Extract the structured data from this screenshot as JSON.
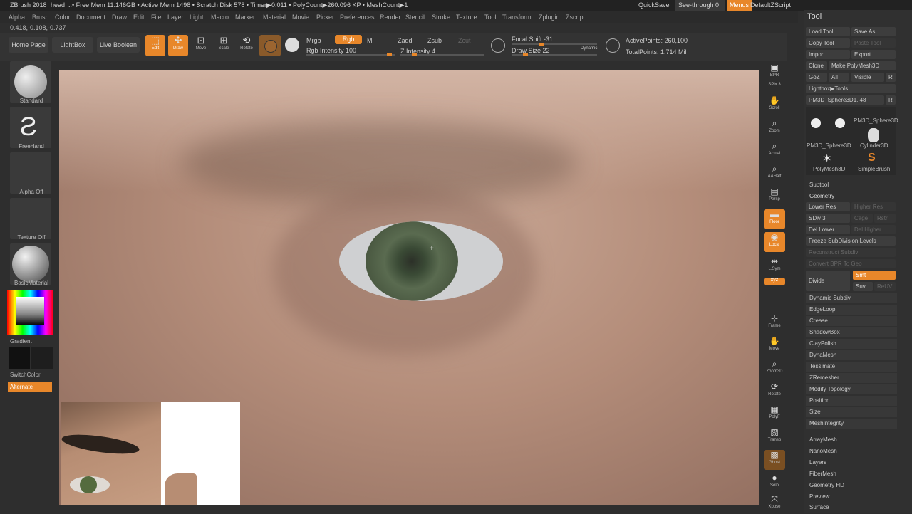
{
  "titlebar": {
    "app": "ZBrush 2018",
    "doc": "head",
    "stats": "..• Free Mem 11.146GB • Active Mem 1498 • Scratch Disk 578 • Timer▶0.011 • PolyCount▶260.096 KP • MeshCount▶1",
    "quicksave": "QuickSave",
    "see_through": "See-through  0",
    "menus": "Menus",
    "default_zscript": "DefaultZScript"
  },
  "menubar": [
    "Alpha",
    "Brush",
    "Color",
    "Document",
    "Draw",
    "Edit",
    "File",
    "Layer",
    "Light",
    "Macro",
    "Marker",
    "Material",
    "Movie",
    "Picker",
    "Preferences",
    "Render",
    "Stencil",
    "Stroke",
    "Texture",
    "Tool",
    "Transform",
    "Zplugin",
    "Zscript"
  ],
  "coords": "0.418,-0.108,-0.737",
  "toolbar": {
    "home_page": "Home Page",
    "lightbox": "LightBox",
    "live_boolean": "Live Boolean",
    "edit": "Edit",
    "draw": "Draw",
    "move": "Move",
    "scale": "Scale",
    "rotate": "Rotate",
    "mrgb": "Mrgb",
    "rgb": "Rgb",
    "m": "M",
    "rgb_intensity": "Rgb Intensity 100",
    "zadd": "Zadd",
    "zsub": "Zsub",
    "zcut": "Zcut",
    "z_intensity": "Z Intensity 4",
    "focal_shift": "Focal Shift -31",
    "draw_size": "Draw Size 22",
    "dynamic": "Dynamic",
    "active_points": "ActivePoints: 260,100",
    "total_points": "TotalPoints: 1.714 Mil"
  },
  "left_shelf": {
    "standard": "Standard",
    "freehand": "FreeHand",
    "alpha_off": "Alpha Off",
    "texture_off": "Texture Off",
    "basic_material": "BasicMaterial",
    "gradient": "Gradient",
    "switch_color": "SwitchColor",
    "alternate": "Alternate"
  },
  "right_shelf": [
    "BPR",
    "SPix 3",
    "Scroll",
    "Zoom",
    "Actual",
    "AAHalf",
    "Persp",
    "Floor",
    "Local",
    "L.Sym",
    "Frame",
    "Move",
    "Zoom3D",
    "Rotate",
    "PolyF",
    "Transp",
    "Ghost",
    "Solo",
    "Xpose"
  ],
  "tool_panel": {
    "title": "Tool",
    "load_tool": "Load Tool",
    "save_as": "Save As",
    "copy_tool": "Copy Tool",
    "paste_tool": "Paste Tool",
    "import": "Import",
    "export": "Export",
    "clone": "Clone",
    "make_polymesh": "Make PolyMesh3D",
    "goz": "GoZ",
    "all": "All",
    "visible": "Visible",
    "r": "R",
    "lightbox_tools": "Lightbox▶Tools",
    "current_tool": "PM3D_Sphere3D1. 48",
    "thumbs": [
      "PM3D_Sphere3D",
      "PM3D_Sphere3D",
      "Cylinder3D",
      "PolyMesh3D",
      "SimpleBrush"
    ],
    "subtool": "Subtool",
    "geometry": "Geometry",
    "lower_res": "Lower Res",
    "higher_res": "Higher Res",
    "sdiv": "SDiv 3",
    "cage": "Cage",
    "rstr": "Rstr",
    "del_lower": "Del Lower",
    "del_higher": "Del Higher",
    "freeze": "Freeze SubDivision Levels",
    "reconstruct": "Reconstruct Subdiv",
    "convert_bpr": "Convert BPR To Geo",
    "divide": "Divide",
    "smt": "Smt",
    "suv": "Suv",
    "reuv": "ReUV",
    "sections": [
      "Dynamic Subdiv",
      "EdgeLoop",
      "Crease",
      "ShadowBox",
      "ClayPolish",
      "DynaMesh",
      "Tessimate",
      "ZRemesher",
      "Modify Topology",
      "Position",
      "Size",
      "MeshIntegrity"
    ],
    "sections2": [
      "ArrayMesh",
      "NanoMesh",
      "Layers",
      "FiberMesh",
      "Geometry HD",
      "Preview",
      "Surface"
    ]
  },
  "colors": {
    "accent": "#e8872a",
    "panel": "#303030"
  }
}
